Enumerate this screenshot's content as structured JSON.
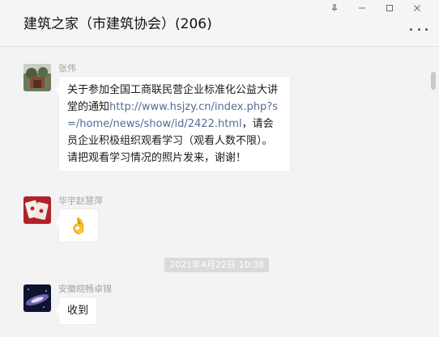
{
  "window": {
    "title": "建筑之家（市建筑协会）(206)",
    "controls": [
      {
        "name": "pin",
        "glyph": "⊥"
      },
      {
        "name": "minimize",
        "glyph": "—"
      },
      {
        "name": "maximize",
        "glyph": "□"
      },
      {
        "name": "close",
        "glyph": "✕"
      }
    ]
  },
  "messages": [
    {
      "sender": "张伟",
      "text_before": "关于参加全国工商联民营企业标准化公益大讲堂的通知",
      "link": "http://www.hsjzy.cn/index.php?s=/home/news/show/id/2422.html",
      "text_after": "，请会员企业积极组织观看学习（观看人数不限）。请把观看学习情况的照片发来，谢谢！"
    },
    {
      "sender": "华宇赵慧萍",
      "emoji": "👌"
    },
    {
      "timestamp": "2021年4月22日 10:38"
    },
    {
      "sender": "安徽皖畅卓锦",
      "text": "收到"
    }
  ],
  "colors": {
    "link": "#576b95",
    "bubble": "#ffffff",
    "background": "#f3f3f3",
    "timestamp_bg": "#dadada"
  }
}
